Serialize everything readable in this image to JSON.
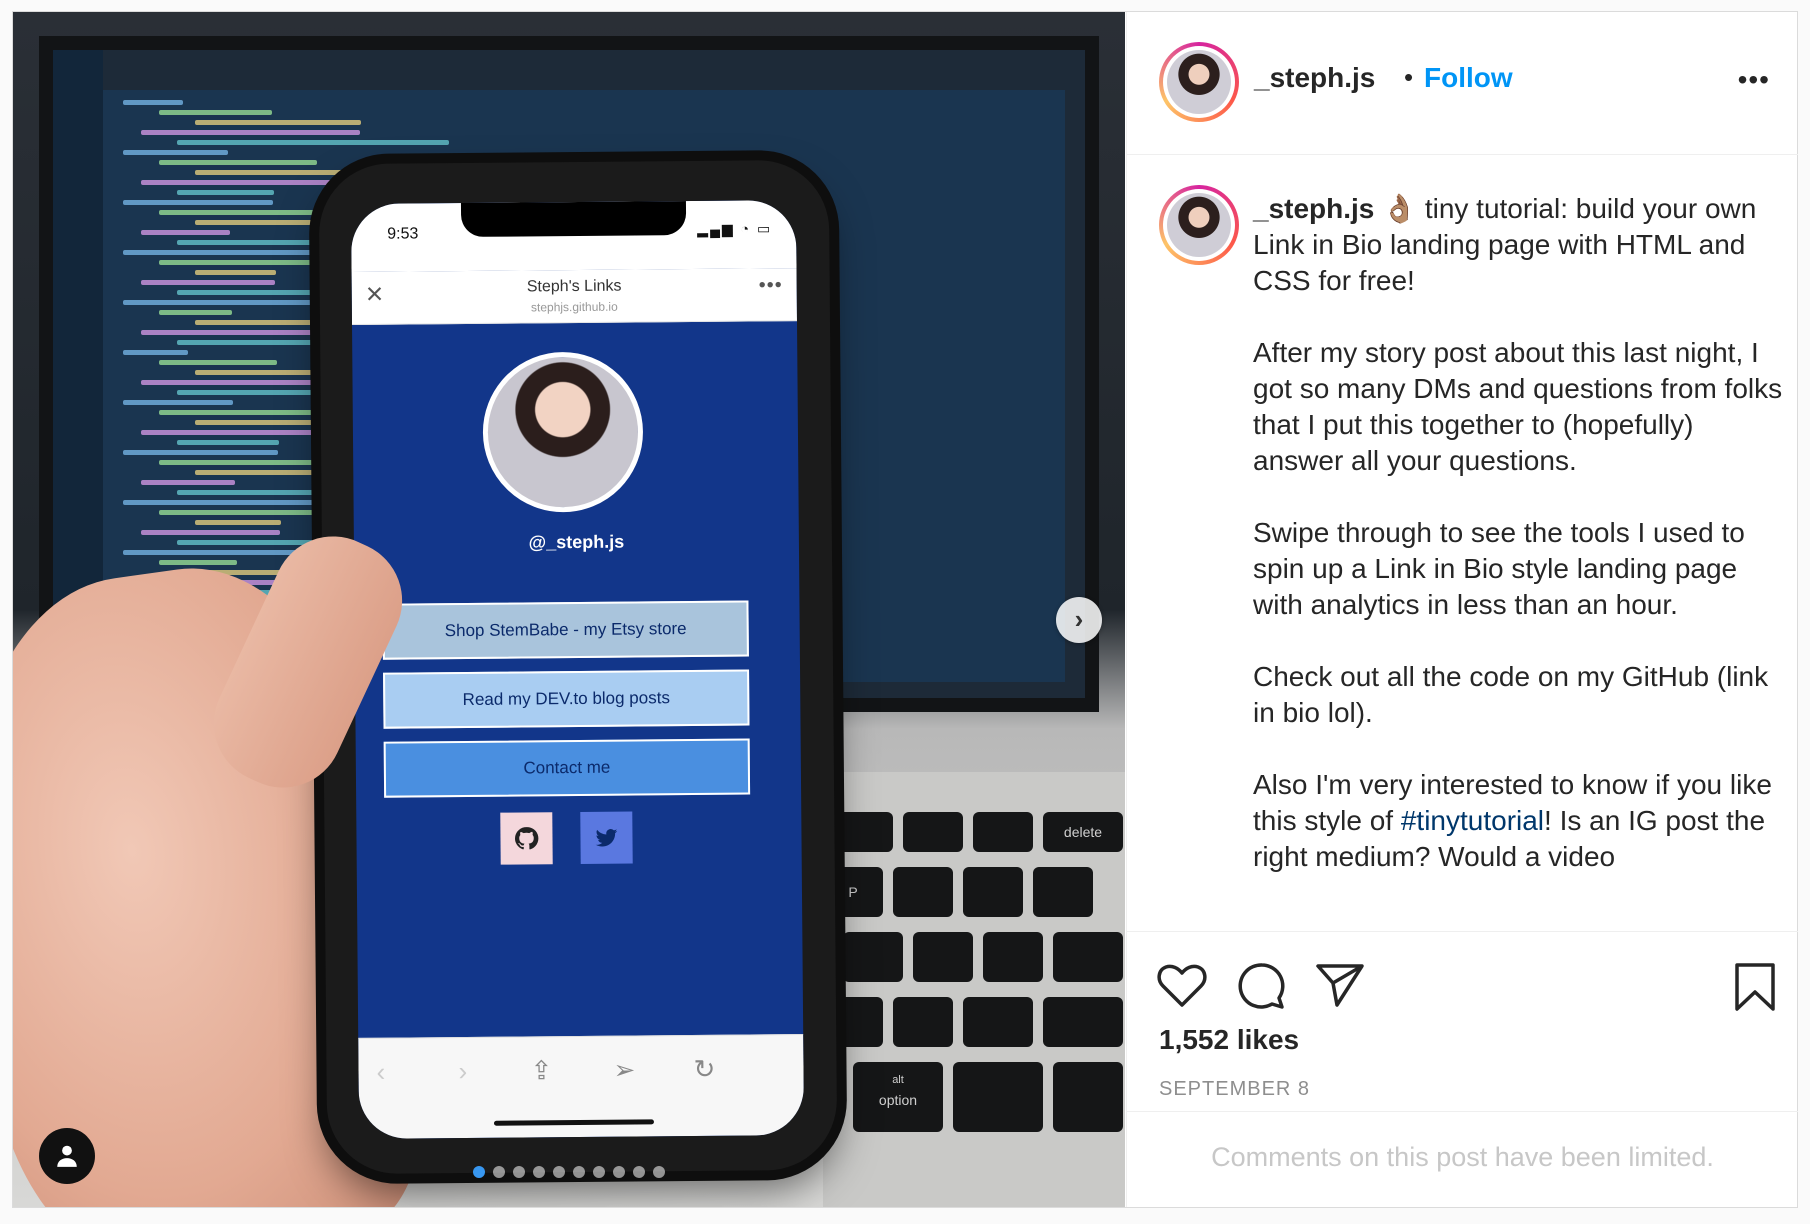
{
  "header": {
    "username": "_steph.js",
    "separator": "•",
    "follow_label": "Follow",
    "more_label": "•••"
  },
  "caption": {
    "username": "_steph.js",
    "emoji": "👌🏽",
    "text_before_hashtag": " tiny tutorial: build your own Link in Bio landing page with HTML and CSS for free!\n\nAfter my story post about this last night, I got so many DMs and questions from folks that I put this together to (hopefully) answer all your questions.\n\nSwipe through to see the tools I used to spin up a Link in Bio style landing page with analytics in less than an hour.\n\nCheck out all the code on my GitHub (link in bio lol).\n\nAlso I'm very interested to know if you like this style of ",
    "hashtag": "#tinytutorial",
    "text_after_hashtag": "! Is an IG post the right medium? Would a video"
  },
  "actions": {
    "likes": "1,552 likes",
    "date": "SEPTEMBER 8"
  },
  "comments": {
    "limited_text": "Comments on this post have been limited."
  },
  "photo": {
    "phone_time": "9:53",
    "page_title": "Steph's Links",
    "page_url": "stephjs.github.io",
    "profile_handle": "@_steph.js",
    "links": [
      {
        "label": "Shop StemBabe - my Etsy store",
        "color": "#a9c4dc"
      },
      {
        "label": "Read my DEV.to blog posts",
        "color": "#a9cdf2"
      },
      {
        "label": "Contact me",
        "color": "#4a8fe0"
      }
    ],
    "keyboard_keys": [
      "option",
      "alt",
      "delete",
      "P"
    ],
    "carousel_total": 10,
    "carousel_active": 1
  },
  "colors": {
    "follow": "#0095f6",
    "hashtag": "#00376b",
    "phone_page_bg": "#12368a"
  }
}
